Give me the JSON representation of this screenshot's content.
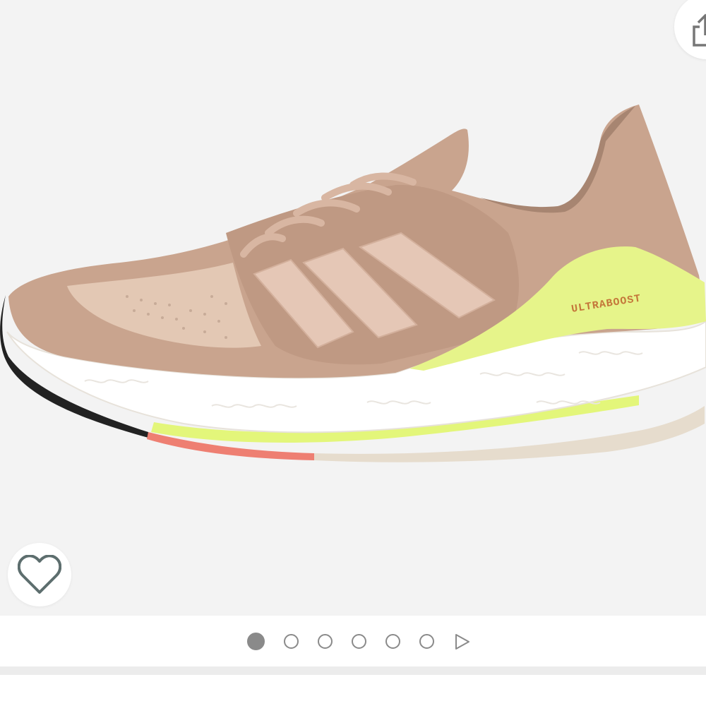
{
  "gallery": {
    "image": {
      "alt": "",
      "brand_text": "ULTRABOOST",
      "colors": {
        "background": "#f3f3f3",
        "upper": "#c9a48e",
        "upper_light": "#e3c8b4",
        "stripes": "#e5c7b6",
        "heel_accent": "#e6f48a",
        "midsole": "#ffffff",
        "outsole_coral": "#ee7f72",
        "outsole_lime": "#e3f67a",
        "outsole_black": "#222222",
        "outsole_cream": "#e6dccd"
      }
    },
    "share": {
      "icon": "share-icon"
    },
    "wishlist": {
      "icon": "heart-outline-icon"
    },
    "pager": {
      "image_count": 6,
      "active_index": 0,
      "video_icon": "play-triangle-icon",
      "dot_color": "#8a8a8a"
    }
  }
}
